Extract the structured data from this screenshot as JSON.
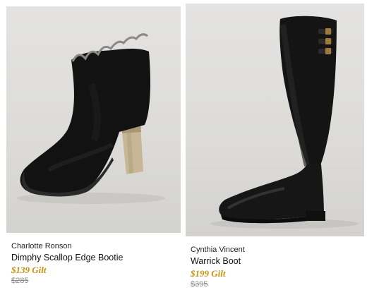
{
  "products": [
    {
      "brand": "Charlotte Ronson",
      "name": "Dimphy Scallop Edge Bootie",
      "sale_price": "$139 Gilt",
      "original_price": "$285",
      "image": "black-suede-scallop-bootie-photo"
    },
    {
      "brand": "Cynthia Vincent",
      "name": "Warrick Boot",
      "sale_price": "$199 Gilt",
      "original_price": "$395",
      "image": "black-leather-tall-boot-photo"
    }
  ],
  "colors": {
    "sale_price": "#c7920e",
    "original_price": "#8c8c8c",
    "photo_background": "#dedddb"
  }
}
